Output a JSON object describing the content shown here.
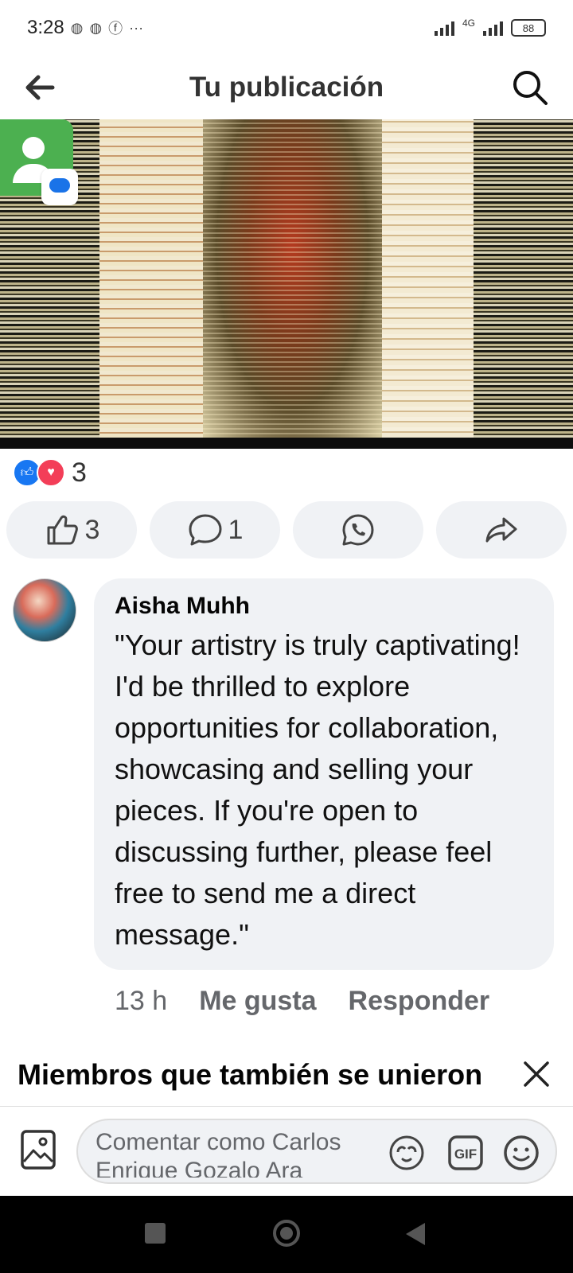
{
  "status_bar": {
    "time": "3:28",
    "notification_icons": [
      "messenger-icon",
      "messenger-icon",
      "facebook-icon"
    ],
    "more": "···",
    "network": "4G",
    "battery": "88"
  },
  "header": {
    "title": "Tu publicación"
  },
  "post": {
    "reaction_count": "3",
    "actions": {
      "like_count": "3",
      "comment_count": "1"
    }
  },
  "comment": {
    "author": "Aisha Muhh",
    "text": "\"Your artistry is truly captivating! I'd be thrilled to explore opportunities for collaboration, showcasing and selling your pieces. If you're open to discussing further, please feel free to send me a direct message.\"",
    "time": "13 h",
    "like_label": "Me gusta",
    "reply_label": "Responder"
  },
  "members_section": {
    "title": "Miembros que también se unieron"
  },
  "composer": {
    "placeholder": "Comentar como Carlos Enrique Gozalo Ara"
  },
  "colors": {
    "accent": "#1877f2",
    "love": "#f33e58",
    "bubble": "#f0f2f5",
    "muted_text": "#65676b"
  }
}
